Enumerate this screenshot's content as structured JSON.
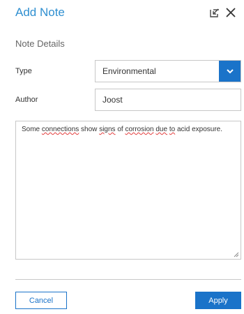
{
  "dialog": {
    "title": "Add Note",
    "section_title": "Note Details",
    "icons": {
      "minimize": "minimize-to-corner-icon",
      "close": "close-icon"
    }
  },
  "form": {
    "type_label": "Type",
    "type_value": "Environmental",
    "author_label": "Author",
    "author_value": "Joost",
    "note_text_parts": [
      {
        "text": "Some ",
        "misspelled": false
      },
      {
        "text": "connections",
        "misspelled": true
      },
      {
        "text": " show ",
        "misspelled": false
      },
      {
        "text": "signs",
        "misspelled": true
      },
      {
        "text": " of ",
        "misspelled": false
      },
      {
        "text": "corrosion",
        "misspelled": true
      },
      {
        "text": " ",
        "misspelled": false
      },
      {
        "text": "due",
        "misspelled": true
      },
      {
        "text": " ",
        "misspelled": false
      },
      {
        "text": "to",
        "misspelled": true
      },
      {
        "text": " acid exposure.",
        "misspelled": false
      }
    ]
  },
  "footer": {
    "cancel_label": "Cancel",
    "apply_label": "Apply"
  },
  "colors": {
    "accent": "#1a73c9",
    "title": "#2f8fd0",
    "spellcheck": "#e23b3b"
  }
}
